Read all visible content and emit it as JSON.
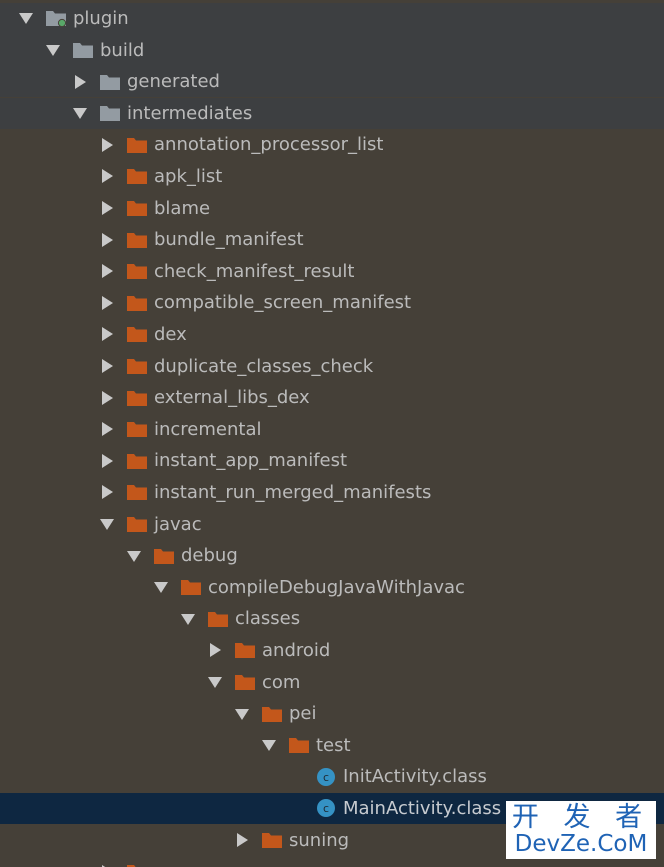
{
  "colors": {
    "excluded_folder": "#939ba2",
    "folder": "#c3571b",
    "class_icon": "#3592c4",
    "selection": "#0e2741",
    "background": "#454038",
    "excluded_background": "#3d3f41"
  },
  "tree": [
    {
      "label": "plugin",
      "depth": 0,
      "expanded": true,
      "icon": "module-folder-icon",
      "excluded": true
    },
    {
      "label": "build",
      "depth": 1,
      "expanded": true,
      "icon": "excluded-folder-icon",
      "excluded": true
    },
    {
      "label": "generated",
      "depth": 2,
      "expanded": false,
      "icon": "excluded-folder-icon",
      "excluded": true
    },
    {
      "label": "intermediates",
      "depth": 2,
      "expanded": true,
      "icon": "excluded-folder-icon",
      "excluded": true
    },
    {
      "label": "annotation_processor_list",
      "depth": 3,
      "expanded": false,
      "icon": "folder-icon"
    },
    {
      "label": "apk_list",
      "depth": 3,
      "expanded": false,
      "icon": "folder-icon"
    },
    {
      "label": "blame",
      "depth": 3,
      "expanded": false,
      "icon": "folder-icon"
    },
    {
      "label": "bundle_manifest",
      "depth": 3,
      "expanded": false,
      "icon": "folder-icon"
    },
    {
      "label": "check_manifest_result",
      "depth": 3,
      "expanded": false,
      "icon": "folder-icon"
    },
    {
      "label": "compatible_screen_manifest",
      "depth": 3,
      "expanded": false,
      "icon": "folder-icon"
    },
    {
      "label": "dex",
      "depth": 3,
      "expanded": false,
      "icon": "folder-icon"
    },
    {
      "label": "duplicate_classes_check",
      "depth": 3,
      "expanded": false,
      "icon": "folder-icon"
    },
    {
      "label": "external_libs_dex",
      "depth": 3,
      "expanded": false,
      "icon": "folder-icon"
    },
    {
      "label": "incremental",
      "depth": 3,
      "expanded": false,
      "icon": "folder-icon"
    },
    {
      "label": "instant_app_manifest",
      "depth": 3,
      "expanded": false,
      "icon": "folder-icon"
    },
    {
      "label": "instant_run_merged_manifests",
      "depth": 3,
      "expanded": false,
      "icon": "folder-icon"
    },
    {
      "label": "javac",
      "depth": 3,
      "expanded": true,
      "icon": "folder-icon"
    },
    {
      "label": "debug",
      "depth": 4,
      "expanded": true,
      "icon": "folder-icon"
    },
    {
      "label": "compileDebugJavaWithJavac",
      "depth": 5,
      "expanded": true,
      "icon": "folder-icon"
    },
    {
      "label": "classes",
      "depth": 6,
      "expanded": true,
      "icon": "folder-icon"
    },
    {
      "label": "android",
      "depth": 7,
      "expanded": false,
      "icon": "folder-icon"
    },
    {
      "label": "com",
      "depth": 7,
      "expanded": true,
      "icon": "folder-icon"
    },
    {
      "label": "pei",
      "depth": 8,
      "expanded": true,
      "icon": "folder-icon"
    },
    {
      "label": "test",
      "depth": 9,
      "expanded": true,
      "icon": "folder-icon"
    },
    {
      "label": "InitActivity.class",
      "depth": 10,
      "leaf": true,
      "icon": "class-file-icon"
    },
    {
      "label": "MainActivity.class",
      "depth": 10,
      "leaf": true,
      "icon": "class-file-icon",
      "selected": true
    },
    {
      "label": "suning",
      "depth": 8,
      "expanded": false,
      "icon": "folder-icon"
    },
    {
      "label": "",
      "depth": 3,
      "expanded": false,
      "icon": "folder-icon"
    }
  ],
  "watermark": {
    "top": "开 发 者",
    "bottom": "DevZe.CoM"
  }
}
